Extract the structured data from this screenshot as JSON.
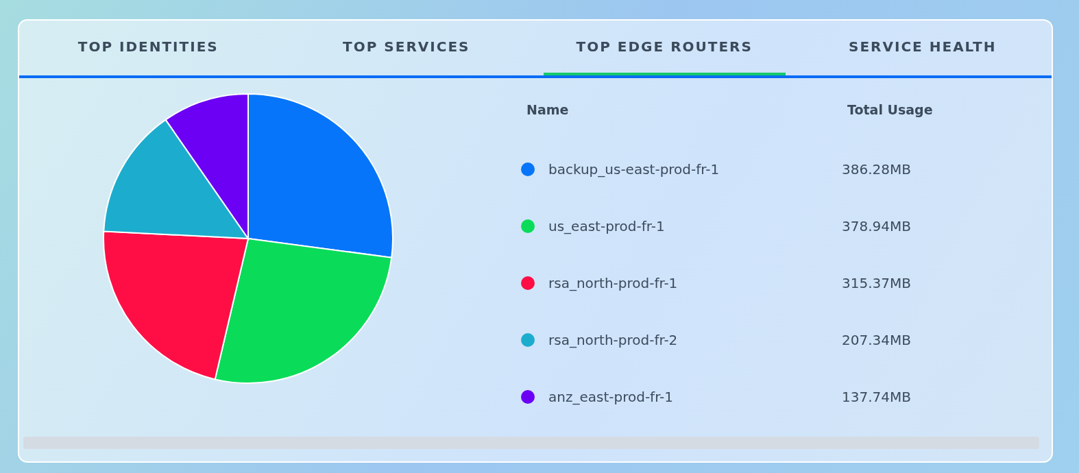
{
  "tabs": [
    {
      "label": "TOP IDENTITIES",
      "selected": false
    },
    {
      "label": "TOP SERVICES",
      "selected": false
    },
    {
      "label": "TOP EDGE ROUTERS",
      "selected": true
    },
    {
      "label": "SERVICE HEALTH",
      "selected": false
    }
  ],
  "table": {
    "columns": [
      "Name",
      "Total Usage"
    ],
    "rows": [
      {
        "name": "backup_us-east-prod-fr-1",
        "usage": "386.28MB",
        "color": "#0675fa"
      },
      {
        "name": "us_east-prod-fr-1",
        "usage": "378.94MB",
        "color": "#0adc5a"
      },
      {
        "name": "rsa_north-prod-fr-1",
        "usage": "315.37MB",
        "color": "#ff0e46"
      },
      {
        "name": "rsa_north-prod-fr-2",
        "usage": "207.34MB",
        "color": "#1cadce"
      },
      {
        "name": "anz_east-prod-fr-1",
        "usage": "137.74MB",
        "color": "#6c00f5"
      }
    ]
  },
  "chart_data": {
    "type": "pie",
    "values": [
      27.1,
      26.58,
      22.12,
      14.54,
      9.66
    ]
  }
}
